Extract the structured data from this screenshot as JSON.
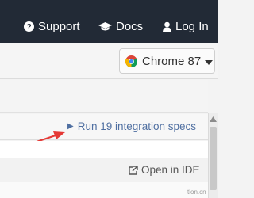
{
  "nav": {
    "support_label": "Support",
    "docs_label": "Docs",
    "login_label": "Log In"
  },
  "browser_selector": {
    "label": "Chrome 87",
    "icon": "chrome-icon"
  },
  "specs": {
    "run_label": "Run 19 integration specs",
    "open_ide_label": "Open in IDE"
  },
  "watermark": "tlon.cn",
  "colors": {
    "nav_bg": "#222a36",
    "link_blue": "#4f6fa1",
    "annotation_red": "#e53935"
  }
}
